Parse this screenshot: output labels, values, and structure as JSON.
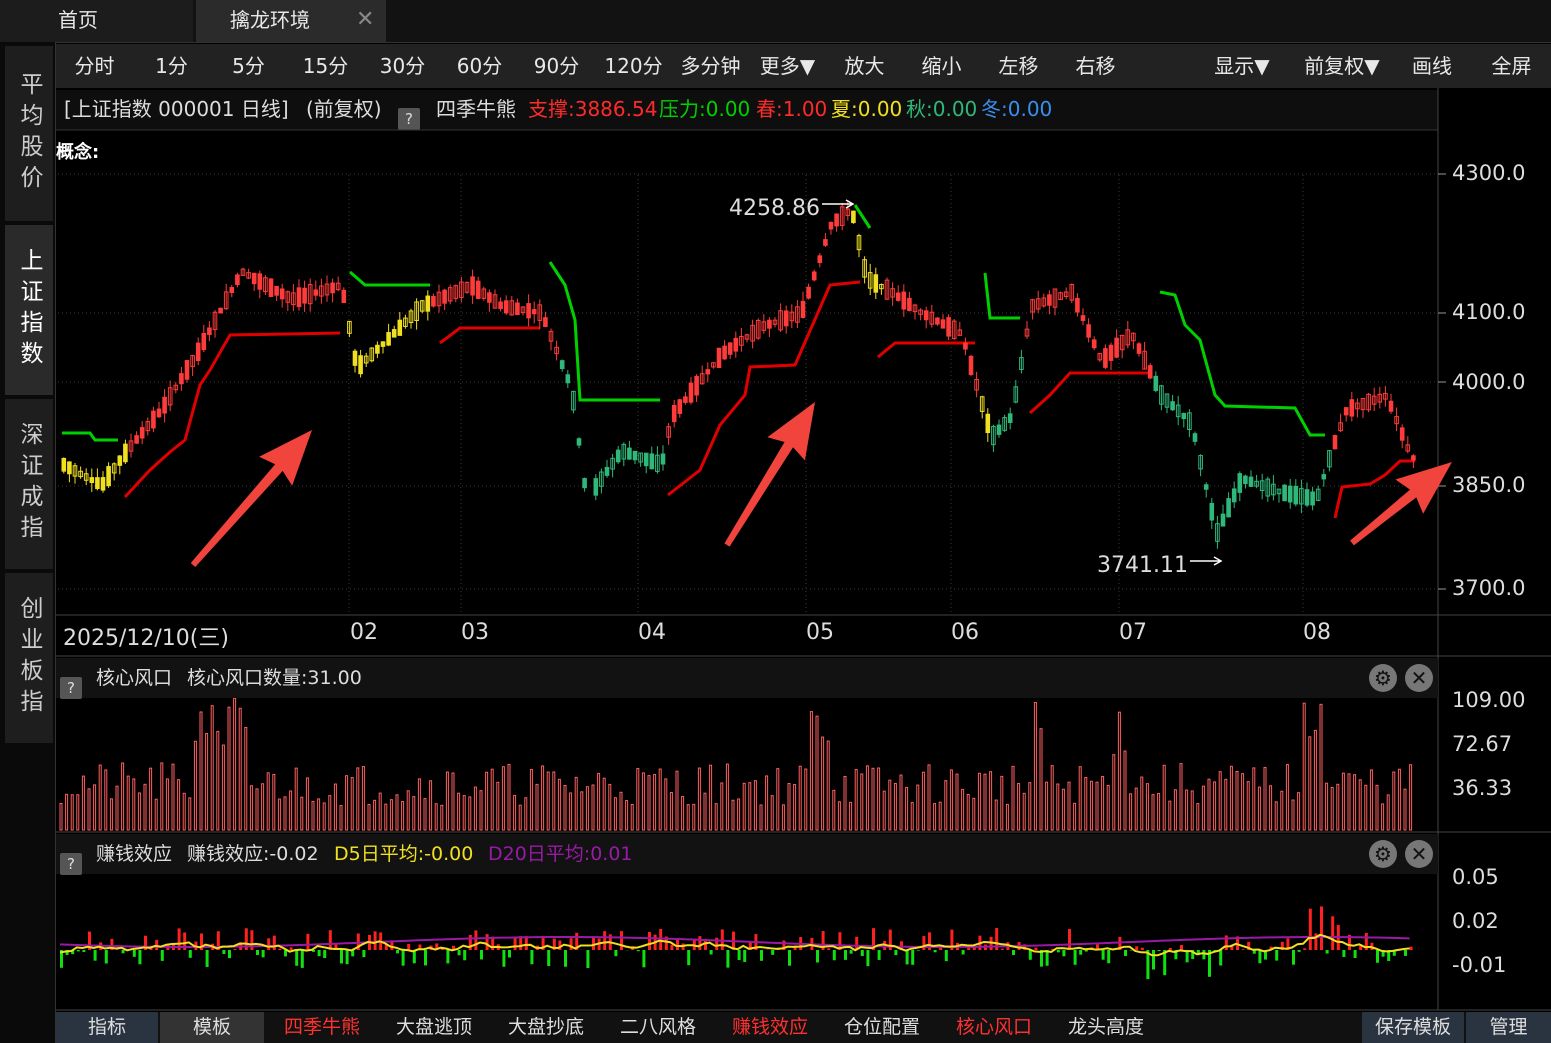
{
  "tabs": {
    "home": "首页",
    "active": "擒龙环境",
    "close": "✕"
  },
  "sidebar": [
    "平均股价",
    "上证指数",
    "深证成指",
    "创业板指"
  ],
  "toolbar": [
    "分时",
    "1分",
    "5分",
    "15分",
    "30分",
    "60分",
    "90分",
    "120分",
    "多分钟",
    "更多▼",
    "放大",
    "缩小",
    "左移",
    "右移",
    "",
    "显示▼",
    "前复权▼",
    "画线",
    "全屏"
  ],
  "info": {
    "title": "[上证指数 000001 日线]",
    "adjust": "(前复权)",
    "help": "?",
    "indicator": "四季牛熊",
    "support": "支撑:3886.54",
    "pressure": "压力:0.00",
    "spring": "春:1.00",
    "summer": "夏:0.00",
    "autumn": "秋:0.00",
    "winter": "冬:0.00"
  },
  "concept_label": "概念:",
  "main_axis": [
    "4300.0",
    "4100.0",
    "4000.0",
    "3850.0",
    "3700.0"
  ],
  "annotations": {
    "high": "4258.86",
    "low": "3741.11"
  },
  "dates": [
    "2025/12/10(三)",
    "02",
    "03",
    "04",
    "05",
    "06",
    "07",
    "08"
  ],
  "panel1": {
    "help": "?",
    "name": "核心风口",
    "value": "核心风口数量:31.00",
    "axis": [
      "109.00",
      "72.67",
      "36.33"
    ]
  },
  "panel2": {
    "help": "?",
    "name": "赚钱效应",
    "value": "赚钱效应:-0.02",
    "d5": "D5日平均:-0.00",
    "d20": "D20日平均:0.01",
    "axis": [
      "0.05",
      "0.02",
      "-0.01"
    ]
  },
  "bottom": [
    "指标",
    "模板",
    "四季牛熊",
    "大盘逃顶",
    "大盘抄底",
    "二八风格",
    "赚钱效应",
    "仓位配置",
    "核心风口",
    "龙头高度",
    "保存模板",
    "管理"
  ],
  "colors": {
    "up": "#ff3b3b",
    "down": "#2fb87a",
    "yellow": "#f0e020",
    "support": "#e00000",
    "pressure": "#00d000",
    "arrow": "#f0443c",
    "purple": "#9a1aa8"
  }
}
